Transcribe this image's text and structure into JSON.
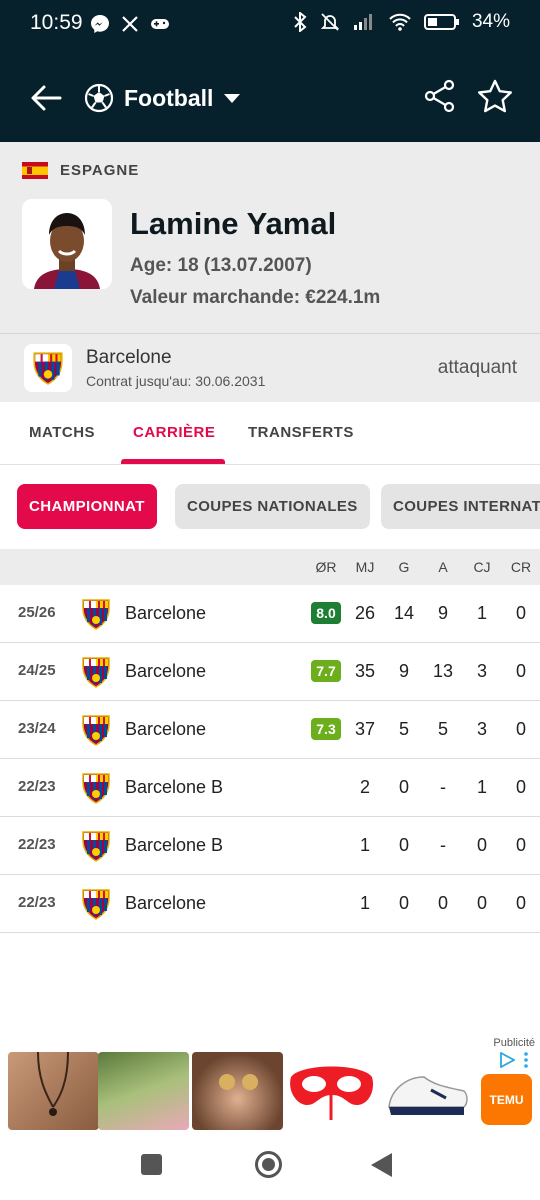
{
  "status_bar": {
    "time": "10:59",
    "battery": "34%"
  },
  "app_bar": {
    "sport": "Football"
  },
  "player": {
    "country": "ESPAGNE",
    "name": "Lamine Yamal",
    "age": "Age: 18 (13.07.2007)",
    "market_value": "Valeur marchande: €224.1m"
  },
  "club": {
    "name": "Barcelone",
    "contract": "Contrat jusqu'au: 30.06.2031",
    "position": "attaquant"
  },
  "tabs": [
    "MATCHS",
    "CARRIÈRE",
    "TRANSFERTS"
  ],
  "active_tab": "CARRIÈRE",
  "chips": [
    "CHAMPIONNAT",
    "COUPES NATIONALES",
    "COUPES INTERNATIONALES"
  ],
  "table": {
    "headers": [
      "ØR",
      "MJ",
      "G",
      "A",
      "CJ",
      "CR"
    ],
    "rows": [
      {
        "season": "25/26",
        "club": "Barcelone",
        "rating": "8.0",
        "rating_color": "#1e7e34",
        "mj": "26",
        "g": "14",
        "a": "9",
        "cj": "1",
        "cr": "0"
      },
      {
        "season": "24/25",
        "club": "Barcelone",
        "rating": "7.7",
        "rating_color": "#6cae1c",
        "mj": "35",
        "g": "9",
        "a": "13",
        "cj": "3",
        "cr": "0"
      },
      {
        "season": "23/24",
        "club": "Barcelone",
        "rating": "7.3",
        "rating_color": "#6cae1c",
        "mj": "37",
        "g": "5",
        "a": "5",
        "cj": "3",
        "cr": "0"
      },
      {
        "season": "22/23",
        "club": "Barcelone B",
        "rating": "",
        "rating_color": "",
        "mj": "2",
        "g": "0",
        "a": "-",
        "cj": "1",
        "cr": "0"
      },
      {
        "season": "22/23",
        "club": "Barcelone B",
        "rating": "",
        "rating_color": "",
        "mj": "1",
        "g": "0",
        "a": "-",
        "cj": "0",
        "cr": "0"
      },
      {
        "season": "22/23",
        "club": "Barcelone",
        "rating": "",
        "rating_color": "",
        "mj": "1",
        "g": "0",
        "a": "0",
        "cj": "0",
        "cr": "0"
      }
    ]
  },
  "ad": {
    "label": "Publicité",
    "brand": "TEMU"
  },
  "colors": {
    "accent": "#e3094b",
    "appbar": "#06212b"
  }
}
